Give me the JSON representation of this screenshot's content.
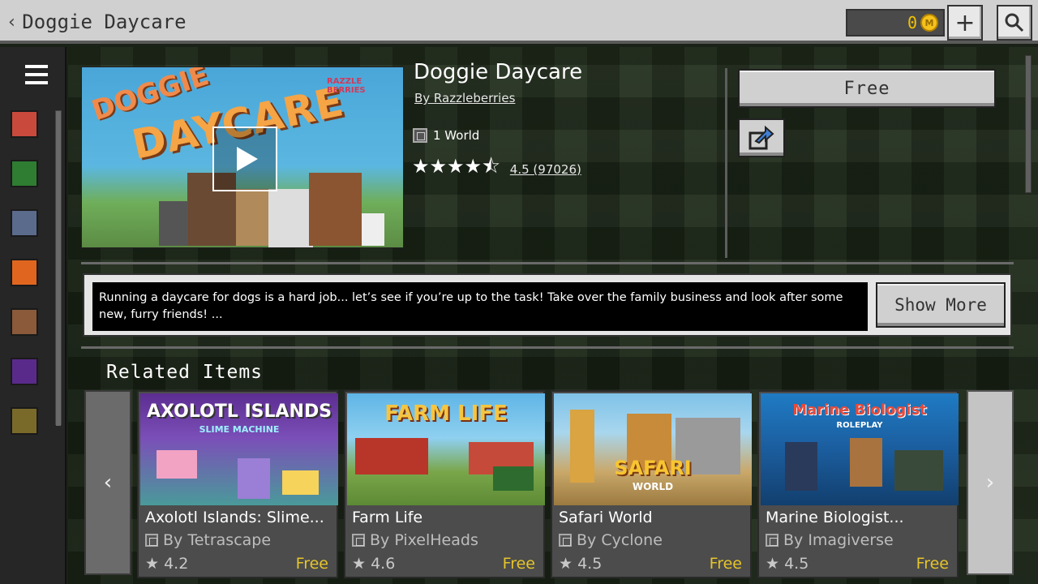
{
  "header": {
    "back_label": "Doggie Daycare",
    "coins": "0",
    "add_label": "+",
    "search_icon": "search-icon"
  },
  "sidebar": {
    "menu_icon": "hamburger-menu-icon",
    "items": [
      {
        "name": "character-creator-icon",
        "color": "#c94a3d"
      },
      {
        "name": "sapling-icon",
        "color": "#2e7d32"
      },
      {
        "name": "computer-icon",
        "color": "#5b6b8c"
      },
      {
        "name": "fire-icon",
        "color": "#e0661f"
      },
      {
        "name": "villager-heart-icon",
        "color": "#8a5a3a"
      },
      {
        "name": "ender-pearl-icon",
        "color": "#5a2a8a"
      },
      {
        "name": "bookshelf-icon",
        "color": "#7a6a2a"
      }
    ]
  },
  "product": {
    "title": "Doggie Daycare",
    "author": "By Razzleberries",
    "type": "1 World",
    "rating_text": "4.5 (97026)",
    "stars": "★★★★⯪",
    "hero_logo_line1": "DOGGIE",
    "hero_logo_line2": "DAYCARE",
    "hero_brand": "RAZZLE BERRIES",
    "price_label": "Free",
    "description": "Running a daycare for dogs is a hard job... let’s see if you’re up to the task! Take over the family business and look after some new, furry friends! ...",
    "show_more_label": "Show More"
  },
  "related": {
    "title": "Related Items",
    "prev_label": "‹",
    "next_label": "›",
    "items": [
      {
        "name": "Axolotl Islands: Slime...",
        "author": "By Tetrascape",
        "rating": "★ 4.2",
        "price": "Free",
        "thumb_text": "AXOLOTL ISLANDS",
        "thumb_sub": "SLIME MACHINE"
      },
      {
        "name": "Farm Life",
        "author": "By PixelHeads",
        "rating": "★ 4.6",
        "price": "Free",
        "thumb_text": "FARM LIFE",
        "thumb_sub": ""
      },
      {
        "name": "Safari World",
        "author": "By Cyclone",
        "rating": "★ 4.5",
        "price": "Free",
        "thumb_text": "SAFARI",
        "thumb_sub": "WORLD"
      },
      {
        "name": "Marine Biologist...",
        "author": "By Imagiverse",
        "rating": "★ 4.5",
        "price": "Free",
        "thumb_text": "Marine Biologist",
        "thumb_sub": "ROLEPLAY"
      }
    ]
  }
}
